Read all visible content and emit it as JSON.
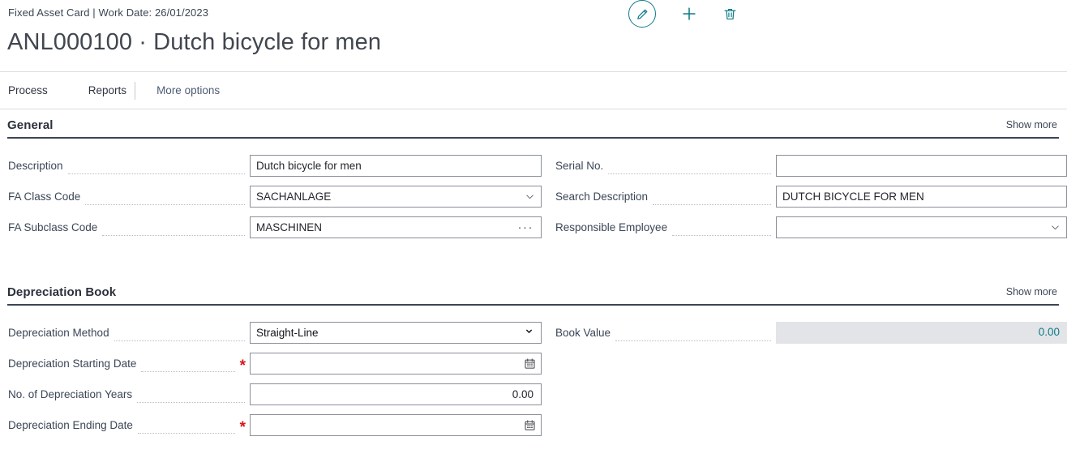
{
  "header": {
    "breadcrumb": "Fixed Asset Card | Work Date: 26/01/2023",
    "title": "ANL000100 · Dutch bicycle for men"
  },
  "top_actions": [
    {
      "name": "edit-button",
      "icon": "pencil-icon",
      "label": "Edit"
    },
    {
      "name": "new-button",
      "icon": "plus-icon",
      "label": "New"
    },
    {
      "name": "delete-button",
      "icon": "trash-icon",
      "label": "Delete"
    }
  ],
  "menubar": {
    "process": "Process",
    "reports": "Reports",
    "more_options": "More options"
  },
  "sections": {
    "general": {
      "title": "General",
      "show_more": "Show more",
      "left": [
        {
          "label": "Description",
          "value": "Dutch bicycle for men",
          "control": "text",
          "required": false
        },
        {
          "label": "FA Class Code",
          "value": "SACHANLAGE",
          "control": "dropdown",
          "required": false
        },
        {
          "label": "FA Subclass Code",
          "value": "MASCHINEN",
          "control": "lookup",
          "required": false
        }
      ],
      "right": [
        {
          "label": "Serial No.",
          "value": "",
          "control": "text",
          "required": false
        },
        {
          "label": "Search Description",
          "value": "DUTCH BICYCLE FOR MEN",
          "control": "text",
          "required": false
        },
        {
          "label": "Responsible Employee",
          "value": "",
          "control": "dropdown",
          "required": false
        }
      ]
    },
    "depreciation_book": {
      "title": "Depreciation Book",
      "show_more": "Show more",
      "left": [
        {
          "label": "Depreciation Method",
          "value": "Straight-Line",
          "control": "select",
          "required": false,
          "options": [
            "Straight-Line"
          ]
        },
        {
          "label": "Depreciation Starting Date",
          "value": "",
          "control": "date",
          "required": true
        },
        {
          "label": "No. of Depreciation Years",
          "value": "0.00",
          "control": "number",
          "required": false
        },
        {
          "label": "Depreciation Ending Date",
          "value": "",
          "control": "date",
          "required": true
        }
      ],
      "right": [
        {
          "label": "Book Value",
          "value": "0.00",
          "control": "readonly",
          "required": false
        }
      ]
    }
  },
  "colors": {
    "accent_teal": "#0f7b87",
    "required_red": "#d7161b",
    "section_rule": "#3c4453",
    "readonly_bg": "#e2e4e7"
  }
}
